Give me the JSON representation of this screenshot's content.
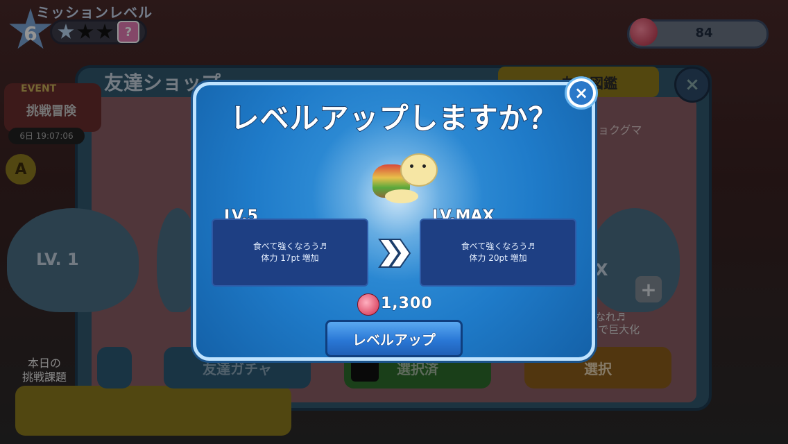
{
  "hud": {
    "mission_title": "ミッションレベル",
    "level": "6",
    "stars": [
      true,
      false,
      false
    ],
    "help_label": "?",
    "currency_value": "84"
  },
  "shop": {
    "title": "友達ショップ",
    "tab_label": "友達図鑑",
    "close_label": "×",
    "event_label": "EVENT",
    "event_sub": "挑戦冒険",
    "event_time": "6日 19:07:06",
    "a_badge": "A",
    "left_card_level": "LV. 1",
    "right_card_level": "X",
    "right_card_name": "ョクグマ",
    "right_desc_1": "なれ♬",
    "right_desc_2": "ーで巨大化",
    "plus_label": "+",
    "daily_task": "本日の\n挑戦課題",
    "gacha_label": "友達ガチャ",
    "selected_label": "選択済",
    "select_label": "選択"
  },
  "modal": {
    "title": "レベルアップしますか？",
    "close_label": "×",
    "current": {
      "level_label": "LV.5",
      "line1": "食べて強くなろう♬",
      "line2": "体力 17pt 増加"
    },
    "next": {
      "level_label": "LV.MAX",
      "line1": "食べて強くなろう♬",
      "line2": "体力 20pt 増加"
    },
    "cost": "1,300",
    "levelup_label": "レベルアップ"
  }
}
